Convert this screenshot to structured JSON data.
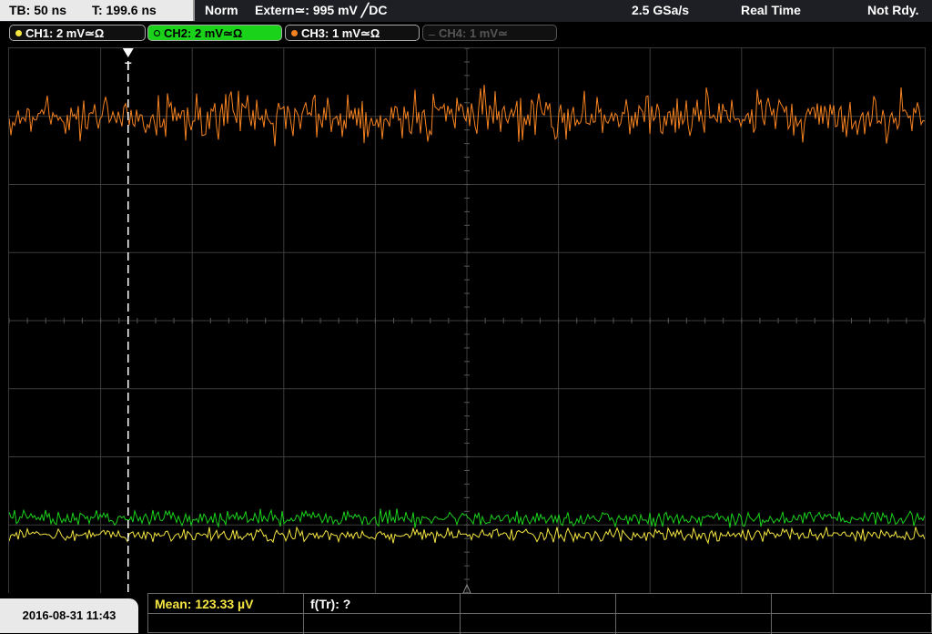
{
  "header": {
    "timebase": "TB: 50 ns",
    "trigger_time": "T: 199.6 ns",
    "trigger_mode": "Norm",
    "trigger_source": "Extern≃: 995 mV ╱DC",
    "sample_rate": "2.5 GSa/s",
    "acq_mode": "Real Time",
    "status": "Not Rdy."
  },
  "channels": [
    {
      "label": "CH1: 2 mV≃Ω",
      "color": "#f5e642",
      "active": true
    },
    {
      "label": "CH2: 2 mV≃Ω",
      "color": "#1bd21b",
      "active": true
    },
    {
      "label": "CH3: 1 mV≃Ω",
      "color": "#f58220",
      "active": true
    },
    {
      "label": "CH4: 1 mV≃",
      "color": "#777777",
      "active": false
    }
  ],
  "colors": {
    "ch1": "#f5e642",
    "ch2": "#1bd21b",
    "ch3": "#f58220",
    "grid": "#3c3c3c",
    "trigger_marker": "#ffffff"
  },
  "waveforms": {
    "ch3_level_divs_from_top": 1.0,
    "ch3_noise_divs": 0.35,
    "ch2_level_divs_from_top": 6.9,
    "ch2_noise_divs": 0.12,
    "ch1_level_divs_from_top": 7.15,
    "ch1_noise_divs": 0.1,
    "trigger_time_divs_from_left": 1.3
  },
  "measurements": {
    "mean": "Mean: 123.33 µV",
    "ftr": "f(Tr): ?"
  },
  "footer": {
    "datetime": "2016-08-31 11:43"
  }
}
